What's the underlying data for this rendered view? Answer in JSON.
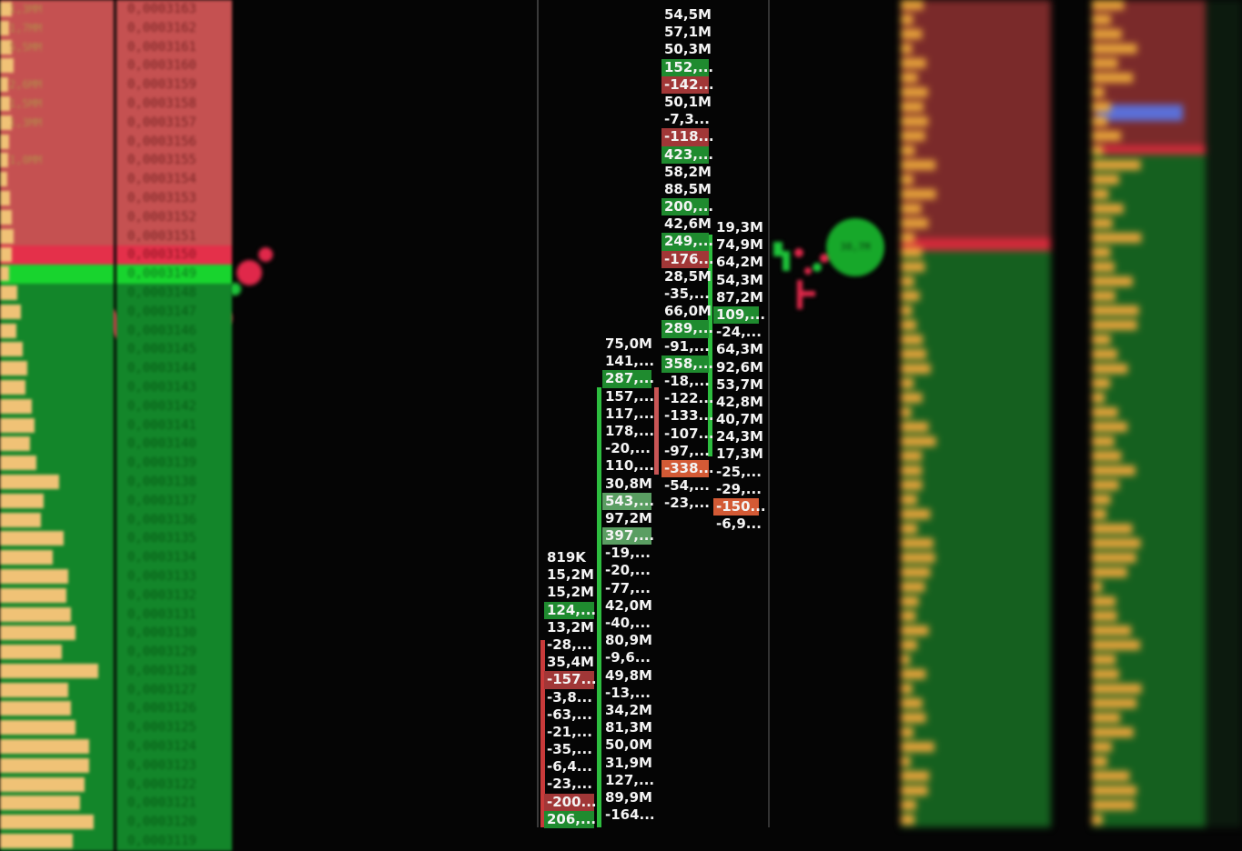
{
  "ladder": {
    "prices": [
      "0,0003163",
      "0,0003162",
      "0,0003161",
      "0,0003160",
      "0,0003159",
      "0,0003158",
      "0,0003157",
      "0,0003156",
      "0,0003155",
      "0,0003154",
      "0,0003153",
      "0,0003152",
      "0,0003151",
      "0,0003150",
      "0,0003149",
      "0,0003148",
      "0,0003147",
      "0,0003146",
      "0,0003145",
      "0,0003144",
      "0,0003143",
      "0,0003142",
      "0,0003141",
      "0,0003140",
      "0,0003139",
      "0,0003138",
      "0,0003137",
      "0,0003136",
      "0,0003135",
      "0,0003134",
      "0,0003133",
      "0,0003132",
      "0,0003131",
      "0,0003130",
      "0,0003129",
      "0,0003128",
      "0,0003127",
      "0,0003126",
      "0,0003125",
      "0,0003124",
      "0,0003123",
      "0,0003122",
      "0,0003121",
      "0,0003120",
      "0,0003119"
    ],
    "best_ask_index": 13,
    "best_bid_index": 14,
    "volume_bars": [
      0.1,
      0.08,
      0.1,
      0.12,
      0.07,
      0.09,
      0.1,
      0.08,
      0.07,
      0.06,
      0.09,
      0.1,
      0.12,
      0.1,
      0.08,
      0.15,
      0.18,
      0.14,
      0.2,
      0.24,
      0.22,
      0.28,
      0.3,
      0.26,
      0.32,
      0.52,
      0.38,
      0.36,
      0.56,
      0.46,
      0.6,
      0.58,
      0.62,
      0.66,
      0.54,
      0.86,
      0.6,
      0.62,
      0.66,
      0.78,
      0.78,
      0.74,
      0.7,
      0.82,
      0.64
    ],
    "volume_labels": [
      "1,3MM",
      "1,7MM",
      "5,5MM",
      "",
      "2,6MM",
      "1,5MM",
      "1,3MM",
      "",
      "1,0MM",
      "",
      "",
      "",
      "",
      "",
      "",
      "",
      "",
      "",
      "",
      "",
      "",
      "",
      "",
      "",
      "",
      "",
      "",
      "",
      "",
      "",
      "",
      "",
      "",
      "",
      "",
      "",
      "",
      "",
      "",
      "",
      "",
      "",
      "",
      "",
      ""
    ]
  },
  "footprint": {
    "col1": {
      "cells": [
        "819K",
        "15,2M",
        "15,2M",
        "124,...",
        "13,2M",
        "-28,...",
        "35,4M",
        "-157...",
        "-3,8...",
        "-63,...",
        "-21,...",
        "-35,...",
        "-6,4...",
        "-23,...",
        "-200...",
        "206,..."
      ],
      "styles": [
        "",
        "",
        "",
        "g1",
        "",
        "",
        "",
        "r1",
        "",
        "",
        "",
        "",
        "",
        "",
        "r1",
        "g1"
      ]
    },
    "col2": {
      "cells": [
        "75,0M",
        "141,...",
        "287,...",
        "157,...",
        "117,...",
        "178,...",
        "-20,...",
        "110,...",
        "30,8M",
        "543,...",
        "97,2M",
        "397,...",
        "-19,...",
        "-20,...",
        "-77,...",
        "42,0M",
        "-40,...",
        "80,9M",
        "-9,6...",
        "49,8M",
        "-13,...",
        "34,2M",
        "81,3M",
        "50,0M",
        "31,9M",
        "127,...",
        "89,9M",
        "-164..."
      ],
      "styles": [
        "",
        "",
        "g1",
        "",
        "",
        "",
        "",
        "",
        "",
        "g2",
        "",
        "g2",
        "",
        "",
        "",
        "",
        "",
        "",
        "",
        "",
        "",
        "",
        "",
        "",
        "",
        "",
        "",
        ""
      ]
    },
    "col3": {
      "cells": [
        "54,5M",
        "57,1M",
        "50,3M",
        "152,...",
        "-142...",
        "50,1M",
        "-7,3...",
        "-118...",
        "423,...",
        "58,2M",
        "88,5M",
        "200,...",
        "42,6M",
        "249,...",
        "-176...",
        "28,5M",
        "-35,...",
        "66,0M",
        "289,...",
        "-91,...",
        "358,...",
        "-18,...",
        "-122...",
        "-133...",
        "-107...",
        "-97,...",
        "-338...",
        "-54,...",
        "-23,..."
      ],
      "styles": [
        "",
        "",
        "",
        "g1",
        "r1",
        "",
        "",
        "r1",
        "g1",
        "",
        "",
        "g1",
        "",
        "g1",
        "r1",
        "",
        "",
        "",
        "g1",
        "",
        "g1",
        "",
        "",
        "",
        "",
        "",
        "o1",
        "",
        ""
      ]
    },
    "col4": {
      "cells": [
        "19,3M",
        "74,9M",
        "64,2M",
        "54,3M",
        "87,2M",
        "109,...",
        "-24,...",
        "64,3M",
        "92,6M",
        "53,7M",
        "42,8M",
        "40,7M",
        "24,3M",
        "17,3M",
        "-25,...",
        "-29,...",
        "-150...",
        "-6,9..."
      ],
      "styles": [
        "",
        "",
        "",
        "",
        "",
        "g1",
        "",
        "",
        "",
        "",
        "",
        "",
        "",
        "",
        "",
        "",
        "o1",
        ""
      ]
    },
    "bubble_label": "38,7M"
  },
  "colors": {
    "ask": "#c55151",
    "bid": "#13862a",
    "best_ask": "#e4304a",
    "best_bid": "#18d42e",
    "volume": "#f0c276",
    "cell_text": "#f4f4f4"
  }
}
